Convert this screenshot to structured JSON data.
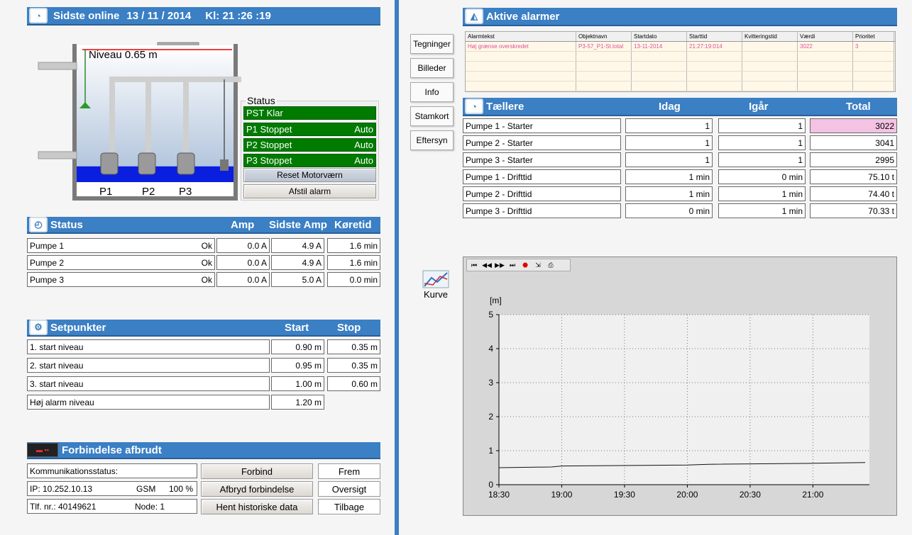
{
  "header": {
    "last_online_label": "Sidste online",
    "date": "13 / 11 / 2014",
    "time": "Kl: 21 :26 :19"
  },
  "tank": {
    "level_label": "Niveau 0.65 m",
    "level_value": 0.65,
    "pumps": [
      "P1",
      "P2",
      "P3"
    ]
  },
  "status_panel": {
    "title": "Status",
    "lines": [
      {
        "label": "PST Klar",
        "mode": ""
      },
      {
        "label": "P1 Stoppet",
        "mode": "Auto"
      },
      {
        "label": "P2 Stoppet",
        "mode": "Auto"
      },
      {
        "label": "P3 Stoppet",
        "mode": "Auto"
      }
    ],
    "reset_button": "Reset Motorværn",
    "ack_button": "Afstil alarm"
  },
  "status_table": {
    "title": "Status",
    "col_amp": "Amp",
    "col_last_amp": "Sidste Amp",
    "col_runtime": "Køretid",
    "rows": [
      {
        "name": "Pumpe 1",
        "state": "Ok",
        "amp": "0.0 A",
        "last_amp": "4.9 A",
        "runtime": "1.6 min"
      },
      {
        "name": "Pumpe 2",
        "state": "Ok",
        "amp": "0.0 A",
        "last_amp": "4.9 A",
        "runtime": "1.6 min"
      },
      {
        "name": "Pumpe 3",
        "state": "Ok",
        "amp": "0.0 A",
        "last_amp": "5.0 A",
        "runtime": "0.0 min"
      }
    ]
  },
  "setpoints": {
    "title": "Setpunkter",
    "col_start": "Start",
    "col_stop": "Stop",
    "rows": [
      {
        "name": "1. start niveau",
        "start": "0.90 m",
        "stop": "0.35 m"
      },
      {
        "name": "2. start niveau",
        "start": "0.95 m",
        "stop": "0.35 m"
      },
      {
        "name": "3. start niveau",
        "start": "1.00 m",
        "stop": "0.60 m"
      },
      {
        "name": "Høj alarm niveau",
        "start": "1.20 m",
        "stop": ""
      }
    ]
  },
  "connection": {
    "title": "Forbindelse afbrudt",
    "comm_status": "Kommunikationsstatus:",
    "ip": "IP: 10.252.10.13",
    "gsm": "GSM",
    "gsm_pct": "100 %",
    "phone": "Tlf. nr.: 40149621",
    "node": "Node: 1",
    "btn_connect": "Forbind",
    "btn_disconnect": "Afbryd forbindelse",
    "btn_history": "Hent historiske data",
    "btn_next": "Frem",
    "btn_overview": "Oversigt",
    "btn_back": "Tilbage"
  },
  "nav": [
    "Tegninger",
    "Billeder",
    "Info",
    "Stamkort",
    "Eftersyn"
  ],
  "alarms": {
    "title": "Aktive alarmer",
    "columns": [
      "Alarmtekst",
      "Objektnavn",
      "Startdato",
      "Starttid",
      "Kvitteringstid",
      "Værdi",
      "Prioritet"
    ],
    "rows": [
      [
        "Høj grænse overskredet",
        "P3-57_P1-St.total",
        "13-11-2014",
        "21:27:19:014",
        "",
        "3022",
        "3"
      ]
    ]
  },
  "counters": {
    "title": "Tællere",
    "col_today": "Idag",
    "col_yesterday": "Igår",
    "col_total": "Total",
    "rows": [
      {
        "name": "Pumpe 1 - Starter",
        "today": "1",
        "yesterday": "1",
        "total": "3022",
        "alarm": true
      },
      {
        "name": "Pumpe 2 - Starter",
        "today": "1",
        "yesterday": "1",
        "total": "3041",
        "alarm": false
      },
      {
        "name": "Pumpe 3 - Starter",
        "today": "1",
        "yesterday": "1",
        "total": "2995",
        "alarm": false
      },
      {
        "name": "Pumpe 1 - Drifttid",
        "today": "1 min",
        "yesterday": "0 min",
        "total": "75.10 t",
        "alarm": false
      },
      {
        "name": "Pumpe 2 - Drifttid",
        "today": "1 min",
        "yesterday": "1 min",
        "total": "74.40 t",
        "alarm": false
      },
      {
        "name": "Pumpe 3 - Drifttid",
        "today": "0 min",
        "yesterday": "1 min",
        "total": "70.33 t",
        "alarm": false
      }
    ]
  },
  "curve_button": "Kurve",
  "toolbar_icons": [
    "first-icon",
    "prev-icon",
    "next-icon",
    "last-icon",
    "stop-icon",
    "export-icon",
    "print-icon"
  ],
  "chart_data": {
    "type": "line",
    "ylabel": "[m]",
    "ylim": [
      0,
      5
    ],
    "yticks": [
      "0",
      "1",
      "2",
      "3",
      "4",
      "5"
    ],
    "xticks": [
      "18:30",
      "19:00",
      "19:30",
      "20:00",
      "20:30",
      "21:00"
    ],
    "x_minutes_range": [
      1110,
      1287
    ],
    "grid": true,
    "series": [
      {
        "x": [
          "18:30",
          "18:55",
          "19:00",
          "20:00",
          "20:10",
          "21:00",
          "21:25"
        ],
        "values": [
          0.5,
          0.52,
          0.55,
          0.58,
          0.6,
          0.63,
          0.65
        ]
      }
    ]
  }
}
